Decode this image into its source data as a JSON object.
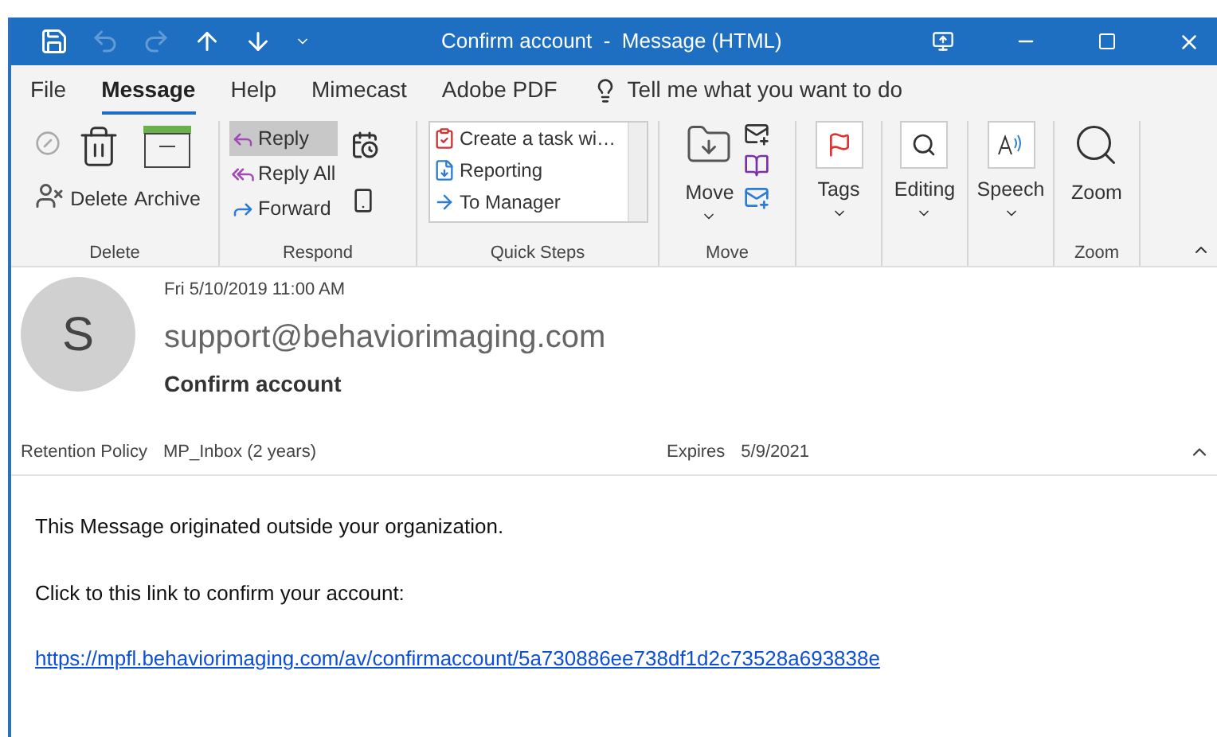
{
  "window": {
    "title": "Confirm account  -  Message (HTML)"
  },
  "menu_tabs": [
    {
      "label": "File",
      "selected": false
    },
    {
      "label": "Message",
      "selected": true
    },
    {
      "label": "Help",
      "selected": false
    },
    {
      "label": "Mimecast",
      "selected": false
    },
    {
      "label": "Adobe PDF",
      "selected": false
    }
  ],
  "tell_me": {
    "placeholder": "Tell me what you want to do"
  },
  "ribbon": {
    "delete": {
      "label": "Delete",
      "delete_button": "Delete",
      "archive_button": "Archive"
    },
    "respond": {
      "label": "Respond",
      "buttons": [
        {
          "label": "Reply",
          "selected": true
        },
        {
          "label": "Reply All",
          "selected": false
        },
        {
          "label": "Forward",
          "selected": false
        }
      ]
    },
    "quick_steps": {
      "label": "Quick Steps",
      "items": [
        "Create a task wi…",
        "Reporting",
        "To Manager"
      ]
    },
    "move": {
      "label": "Move",
      "button": "Move"
    },
    "tags": {
      "button": "Tags"
    },
    "editing": {
      "button": "Editing"
    },
    "speech": {
      "button": "Speech"
    },
    "zoom": {
      "label": "Zoom",
      "button": "Zoom"
    }
  },
  "message": {
    "avatar": "S",
    "date": "Fri 5/10/2019 11:00 AM",
    "sender": "support@behaviorimaging.com",
    "subject": "Confirm account",
    "retention_label": "Retention Policy",
    "retention_value": "MP_Inbox (2 years)",
    "expires_label": "Expires",
    "expires_value": "5/9/2021",
    "body": [
      "This Message originated outside your organization.",
      "Click to this link to confirm your account:"
    ],
    "link": "https://mpfl.behaviorimaging.com/av/confirmaccount/5a730886ee738df1d2c73528a693838e"
  }
}
